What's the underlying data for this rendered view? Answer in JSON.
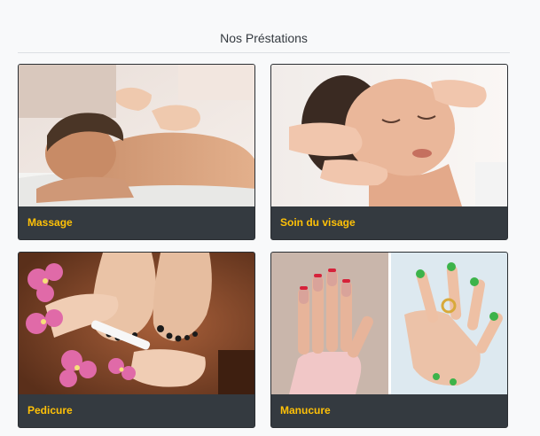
{
  "section": {
    "title": "Nos Préstations"
  },
  "services": [
    {
      "name": "Massage",
      "image": "massage-photo"
    },
    {
      "name": "Soin du visage",
      "image": "facial-care-photo"
    },
    {
      "name": "Pedicure",
      "image": "pedicure-photo"
    },
    {
      "name": "Manucure",
      "image": "manicure-photo"
    }
  ],
  "colors": {
    "caption_bg": "#343a40",
    "caption_text": "#ffc107",
    "page_bg": "#f8f9fa"
  }
}
